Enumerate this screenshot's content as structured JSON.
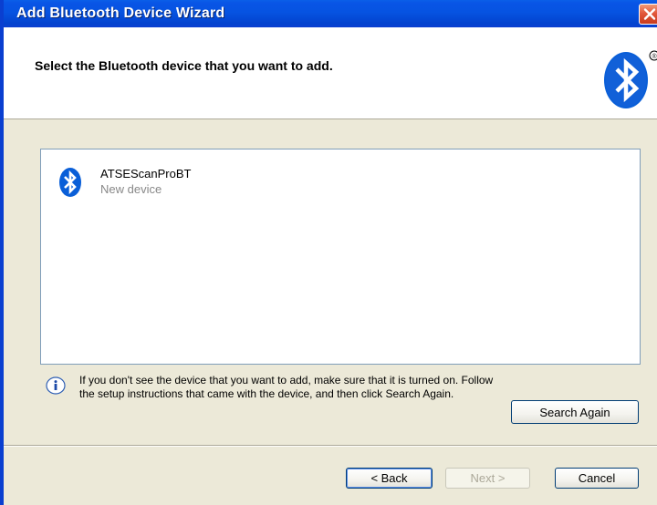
{
  "window": {
    "title": "Add Bluetooth Device Wizard"
  },
  "header": {
    "title": "Select the Bluetooth device that you want to add.",
    "logo_icon": "bluetooth-logo-icon",
    "registered_mark": "®"
  },
  "device_list": {
    "items": [
      {
        "name": "ATSEScanProBT",
        "status": "New device",
        "icon": "bluetooth-device-icon"
      }
    ]
  },
  "info": {
    "icon": "info-icon",
    "text": "If you don't see the device that you want to add, make sure that it is turned on. Follow the setup instructions that came with the device, and then click Search Again."
  },
  "buttons": {
    "search_again": "Search Again",
    "back": "< Back",
    "next": "Next >",
    "cancel": "Cancel"
  },
  "colors": {
    "titlebar": "#0653e1",
    "window_bg": "#ece9d8",
    "bluetooth_blue": "#0a5fd8"
  }
}
